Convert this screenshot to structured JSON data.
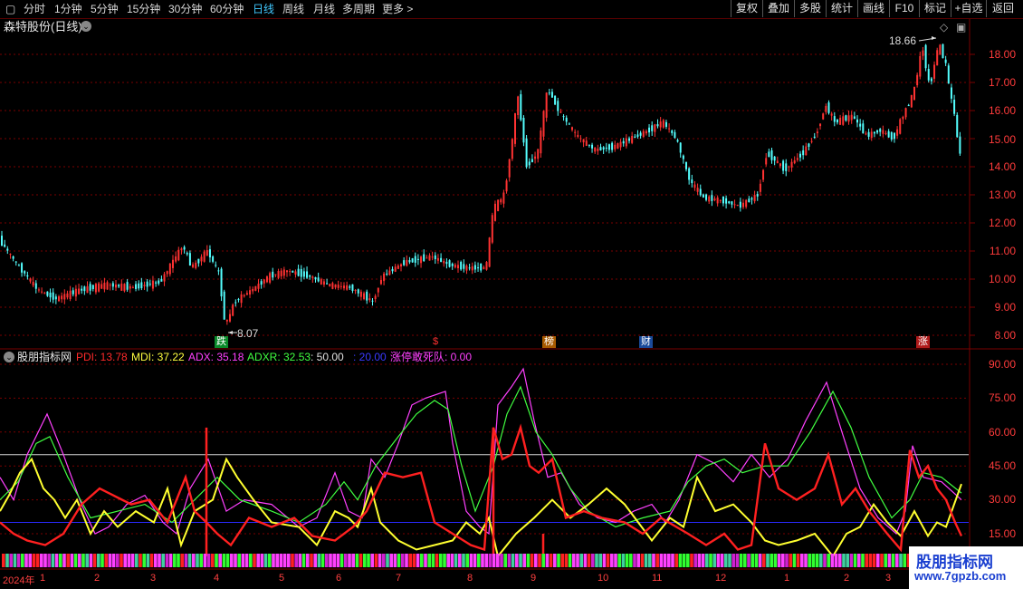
{
  "toolbar": {
    "periods": [
      "分时",
      "1分钟",
      "5分钟",
      "15分钟",
      "30分钟",
      "60分钟",
      "日线",
      "周线",
      "月线",
      "多周期",
      "更多"
    ],
    "active": "日线",
    "right_buttons": [
      "复权",
      "叠加",
      "多股",
      "统计",
      "画线",
      "F10",
      "标记",
      "+自选",
      "返回"
    ]
  },
  "main": {
    "title": "森特股份(日线)",
    "high_label": "18.66",
    "low_label": "8.07",
    "y_ticks": [
      "18.00",
      "17.00",
      "16.00",
      "15.00",
      "14.00",
      "13.00",
      "12.00",
      "11.00",
      "10.00",
      "9.00",
      "8.00"
    ],
    "markers": [
      {
        "text": "跌",
        "color": "#ffffff",
        "bg": "#0a8a2a"
      },
      {
        "text": "$",
        "color": "#ff3030",
        "bg": "#000000"
      },
      {
        "text": "榜",
        "color": "#ffffff",
        "bg": "#a85a00"
      },
      {
        "text": "财",
        "color": "#ffffff",
        "bg": "#1a4a9a"
      },
      {
        "text": "涨",
        "color": "#ffffff",
        "bg": "#b01a1a"
      }
    ]
  },
  "indicator": {
    "name": "股朋指标网",
    "values": [
      {
        "text": "PDI: 13.78",
        "color": "#ff2a2a"
      },
      {
        "text": "MDI: 37.22",
        "color": "#ffff40"
      },
      {
        "text": "ADX: 35.18",
        "color": "#ff40ff"
      },
      {
        "text": "ADXR: 32.53",
        "color": "#40ff40"
      },
      {
        "text": ": 50.00",
        "color": "#e0e0e0"
      },
      {
        "text": ": 20.00",
        "color": "#3a3aff"
      },
      {
        "text": "涨停敢死队: 0.00",
        "color": "#ff40ff"
      }
    ],
    "y_ticks": [
      "90.00",
      "75.00",
      "60.00",
      "45.00",
      "30.00",
      "15.00"
    ]
  },
  "axis": {
    "year": "2024年",
    "months": [
      "1",
      "2",
      "3",
      "4",
      "5",
      "6",
      "7",
      "8",
      "9",
      "10",
      "11",
      "12",
      "1",
      "2",
      "3"
    ]
  },
  "watermark": {
    "line1": "股朋指标网",
    "line2": "www.7gpzb.com"
  },
  "colors": {
    "up": "#ff3232",
    "down": "#54ffff",
    "pdi": "#ff2020",
    "mdi": "#ffff30",
    "adx": "#ff40ff",
    "adxr": "#40ff40",
    "grid": "#7a0000"
  }
}
